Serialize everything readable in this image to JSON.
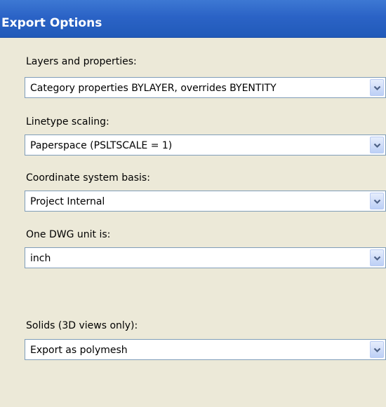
{
  "window": {
    "title": "Export Options"
  },
  "fields": [
    {
      "label": "Layers and properties:",
      "value": "Category properties BYLAYER, overrides BYENTITY"
    },
    {
      "label": "Linetype scaling:",
      "value": "Paperspace (PSLTSCALE = 1)"
    },
    {
      "label": "Coordinate system basis:",
      "value": "Project Internal"
    },
    {
      "label": "One DWG unit is:",
      "value": "inch"
    },
    {
      "label": "Solids (3D views only):",
      "value": "Export as polymesh"
    }
  ],
  "icons": {
    "dropdown": "chevron-down-icon"
  },
  "colors": {
    "header": "#2b63c6",
    "panel": "#ece9d8",
    "field_border": "#7f9db9",
    "dropdown_button": "#cfdcf8",
    "chevron": "#4d6185"
  }
}
